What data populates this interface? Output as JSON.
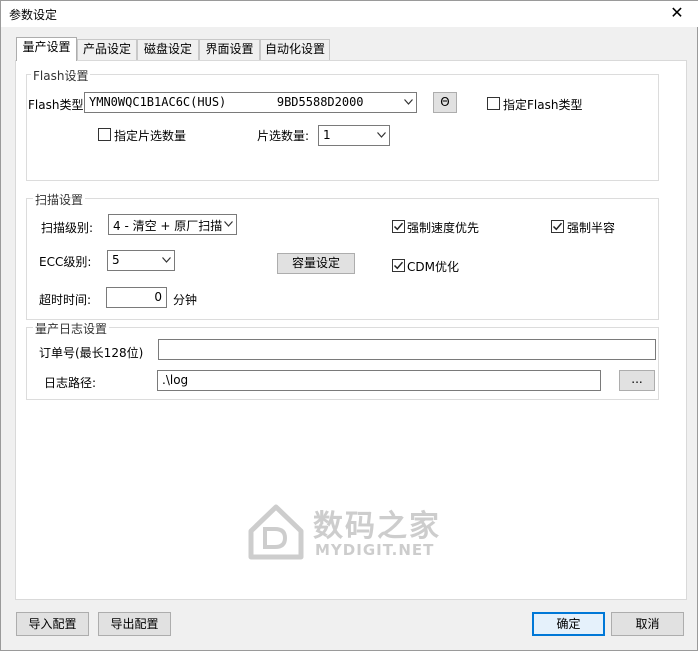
{
  "window": {
    "title": "参数设定",
    "close_glyph": "✕"
  },
  "tabs": [
    {
      "label": "量产设置",
      "active": true
    },
    {
      "label": "产品设定",
      "active": false
    },
    {
      "label": "磁盘设定",
      "active": false
    },
    {
      "label": "界面设置",
      "active": false
    },
    {
      "label": "自动化设置",
      "active": false
    }
  ],
  "flash": {
    "legend": "Flash设置",
    "type_label": "Flash类型:",
    "type_value": "YMN0WQC1B1AC6C(HUS)       9BD5588D2000",
    "extra_button": "Θ",
    "specify_type_label": "指定Flash类型",
    "specify_type_checked": false,
    "specify_chip_label": "指定片选数量",
    "specify_chip_checked": false,
    "chip_count_label": "片选数量:",
    "chip_count_value": "1"
  },
  "scan": {
    "legend": "扫描设置",
    "level_label": "扫描级别:",
    "level_value": "4 - 清空 + 原厂扫描",
    "ecc_label": "ECC级别:",
    "ecc_value": "5",
    "timeout_label": "超时时间:",
    "timeout_value": "0",
    "timeout_unit": "分钟",
    "capacity_button": "容量设定",
    "force_speed_label": "强制速度优先",
    "force_speed_checked": true,
    "force_half_label": "强制半容",
    "force_half_checked": true,
    "cdm_label": "CDM优化",
    "cdm_checked": true
  },
  "log": {
    "legend": "量产日志设置",
    "order_label": "订单号(最长128位)",
    "order_value": "",
    "path_label": "日志路径:",
    "path_value": ".\\log",
    "browse_button": "..."
  },
  "footer": {
    "import_button": "导入配置",
    "export_button": "导出配置",
    "ok_button": "确定",
    "cancel_button": "取消"
  },
  "watermark": {
    "cn_text": "数码之家",
    "en_text": "MYDIGIT.NET"
  },
  "colors": {
    "window_bg": "#f0f0f0",
    "panel_bg": "#ffffff",
    "accent": "#0078d7",
    "button_bg": "#e1e1e1"
  },
  "icons": {
    "close": "close-icon",
    "combo": "chevron-down-icon",
    "check": "checkmark-icon",
    "watermark": "house-logo-icon"
  }
}
